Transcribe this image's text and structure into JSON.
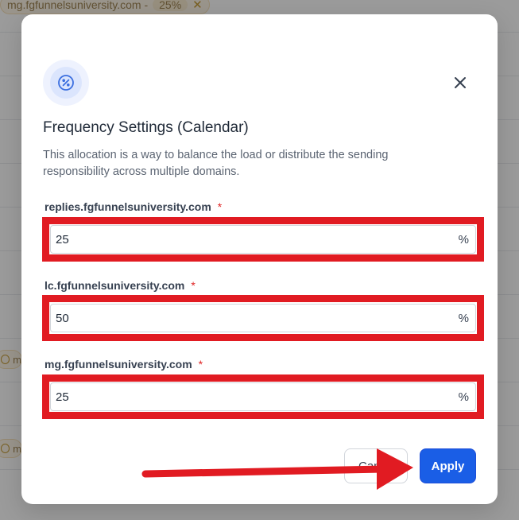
{
  "background": {
    "chip_domain": "mg.fgfunnelsuniversity.com -",
    "chip_percent": "25%",
    "chip_close": "✕",
    "side_chip_letter": "m"
  },
  "modal": {
    "icon": "percent-icon",
    "title": "Frequency Settings (Calendar)",
    "description": "This allocation is a way to balance the load or distribute the sending responsibility across multiple domains.",
    "close_icon": "close-icon",
    "required_mark": "*",
    "fields": [
      {
        "label": "replies.fgfunnelsuniversity.com",
        "value": "25",
        "unit": "%"
      },
      {
        "label": "lc.fgfunnelsuniversity.com",
        "value": "50",
        "unit": "%"
      },
      {
        "label": "mg.fgfunnelsuniversity.com",
        "value": "25",
        "unit": "%"
      }
    ],
    "cancel_label": "Cancel",
    "apply_label": "Apply"
  },
  "annotations": {
    "highlight_color": "#e11b22",
    "arrow_color": "#e11b22",
    "accent_color": "#1a5ee6"
  }
}
